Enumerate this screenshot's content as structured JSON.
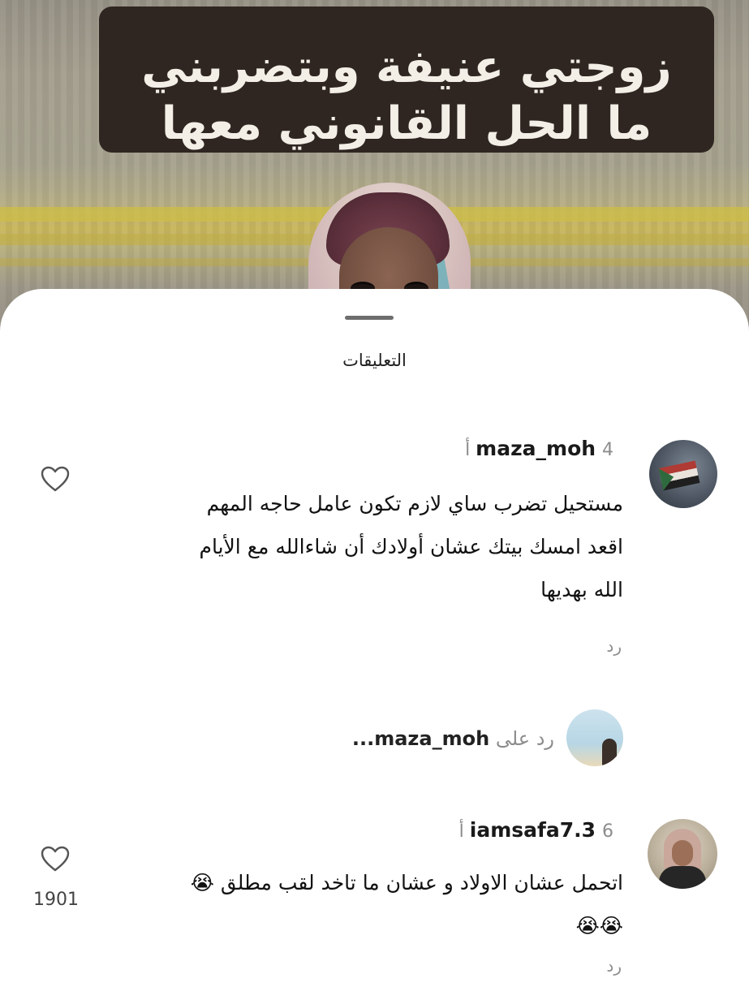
{
  "video": {
    "caption_line1": "زوجتي عنيفة وبتضربني",
    "caption_line2": "ما الحل القانوني معها"
  },
  "sheet": {
    "title": "التعليقات"
  },
  "comments": [
    {
      "username": "maza_moh",
      "time": "4 أ",
      "lines": [
        "مستحيل تضرب ساي لازم تكون عامل حاجه المهم",
        "اقعد امسك بيتك عشان أولادك أن شاءالله مع الأيام",
        "الله بهديها"
      ],
      "reply_label": "رد"
    },
    {
      "username": "iamsafa7.3",
      "time": "6 أ",
      "lines": [
        "اتحمل عشان الاولاد و عشان ما تاخد  لقب مطلق 😭",
        "😭😭"
      ],
      "likes": "1901",
      "reply_label": "رد"
    }
  ],
  "reply_thread": {
    "prefix": "رد على",
    "username": "maza_moh...",
    "text": "رد على maza_moh..."
  },
  "icons": {
    "like": "heart-outline-icon"
  },
  "colors": {
    "caption_bg": "#2f2622",
    "sheet_bg": "#ffffff",
    "muted_text": "#8c8c8c"
  }
}
